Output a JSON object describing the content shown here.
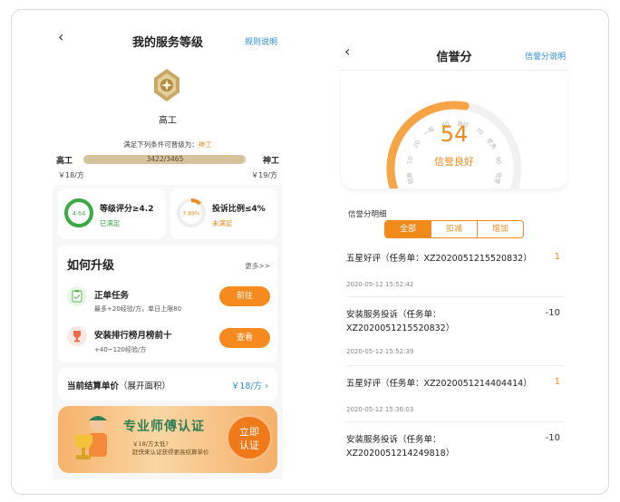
{
  "left": {
    "header": {
      "back": "‹",
      "title": "我的服务等级",
      "rules": "规则说明"
    },
    "level": {
      "name": "高工",
      "upgrade_prefix": "满足下列条件可晋级为：",
      "upgrade_target": "神工",
      "from": "高工",
      "to": "神工",
      "progress_text": "3422/3465",
      "progress_fraction": 0.988,
      "price_from": "￥18/方",
      "price_to": "￥19/方"
    },
    "criteria": [
      {
        "ring_value": "4.64",
        "title": "等级评分≥4.2",
        "status": "已满足",
        "ring_fraction": 1.0,
        "ring_color": "#3aa845"
      },
      {
        "ring_value": "7.69%",
        "title": "投诉比例≤4%",
        "status": "未满足",
        "ring_fraction": 0.12,
        "ring_color": "#f08a1b"
      }
    ],
    "how": {
      "title": "如何升级",
      "more": "更多>>",
      "tasks": [
        {
          "name": "正单任务",
          "desc": "最多+20经验/方，单日上限80",
          "button": "前往",
          "icon": "task-clipboard-icon"
        },
        {
          "name": "安装排行榜月榜前十",
          "desc": "+40~120经验/方",
          "button": "查看",
          "icon": "trophy-icon"
        }
      ]
    },
    "settle": {
      "label": "当前结算单价",
      "note": "（展开面积）",
      "value": "￥18/方 ›"
    },
    "banner": {
      "title": "专业师傅认证",
      "sub1": "￥18/方太低?",
      "sub2": "赶快来认证获得更高结算单价",
      "button_line1": "立即",
      "button_line2": "认证"
    }
  },
  "right": {
    "header": {
      "back": "‹",
      "title": "信誉分",
      "help": "信誉分说明"
    },
    "gauge": {
      "score": "54",
      "label": "信誉良好",
      "scale_labels": [
        "0",
        "较差",
        "10",
        "20",
        "一般",
        "40",
        "良好",
        "70",
        "优秀",
        "90",
        "信誉",
        "100"
      ]
    },
    "detail_label": "信誉分明细",
    "tabs": [
      "全部",
      "扣减",
      "增加"
    ],
    "records": [
      {
        "title": "五星好评（任务单：XZ2020051215520832）",
        "value": "1",
        "time": "2020-05-12 15:52:42",
        "type": "pos"
      },
      {
        "title": "安装服务投诉（任务单：XZ2020051215520832）",
        "value": "-10",
        "time": "2020-05-12 15:52:39",
        "type": "neg"
      },
      {
        "title": "五星好评（任务单：XZ2020051214404414）",
        "value": "1",
        "time": "2020-05-12 15:36:03",
        "type": "pos"
      },
      {
        "title": "安装服务投诉（任务单：XZ2020051214249818）",
        "value": "-10",
        "time": "",
        "type": "neg"
      }
    ]
  }
}
